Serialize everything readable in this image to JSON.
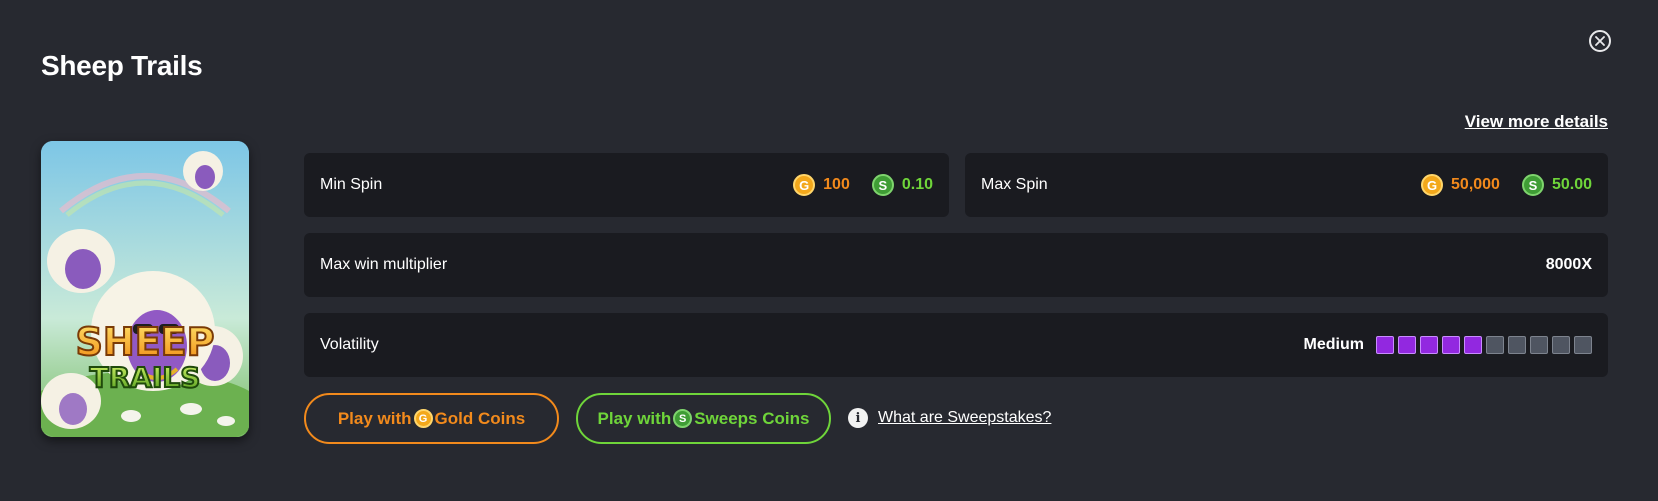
{
  "game": {
    "title": "Sheep Trails",
    "thumbnail_text_line1": "SHEEP",
    "thumbnail_text_line2": "TRAILS"
  },
  "view_more_label": "View more details",
  "min_spin": {
    "label": "Min Spin",
    "gold_value": "100",
    "sweeps_value": "0.10"
  },
  "max_spin": {
    "label": "Max Spin",
    "gold_value": "50,000",
    "sweeps_value": "50.00"
  },
  "max_win": {
    "label": "Max win multiplier",
    "value": "8000X"
  },
  "volatility": {
    "label": "Volatility",
    "value": "Medium",
    "level": 5,
    "max_level": 10
  },
  "buttons": {
    "play_gold_prefix": "Play with",
    "play_gold_suffix": "Gold Coins",
    "play_sweeps_prefix": "Play with",
    "play_sweeps_suffix": "Sweeps Coins"
  },
  "info_link": "What are Sweepstakes?",
  "icons": {
    "gold_coin": "G",
    "sweeps_coin": "S",
    "info": "i",
    "close": "close-icon"
  },
  "colors": {
    "background": "#272930",
    "card": "#1a1b20",
    "gold": "#f28a1c",
    "sweeps": "#6fd53a",
    "volatility_on": "#9228e0",
    "volatility_off": "#4f5561"
  }
}
